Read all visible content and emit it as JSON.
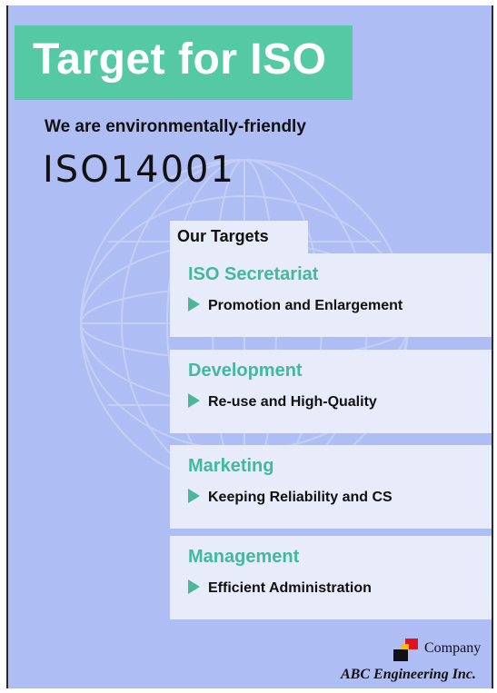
{
  "header": {
    "title": "Target for ISO"
  },
  "intro": {
    "tagline": "We are environmentally-friendly",
    "standard": "ISO14001"
  },
  "targets": {
    "heading": "Our Targets",
    "items": [
      {
        "title": "ISO Secretariat",
        "goal": "Promotion and Enlargement"
      },
      {
        "title": "Development",
        "goal": "Re-use and High-Quality"
      },
      {
        "title": "Marketing",
        "goal": "Keeping Reliability and CS"
      },
      {
        "title": "Management",
        "goal": "Efficient Administration"
      }
    ]
  },
  "footer": {
    "company_word": "Company",
    "company_name": "ABC Engineering Inc."
  },
  "colors": {
    "background": "#aebdf3",
    "banner": "#55c9a4",
    "accent": "#42b99c",
    "card": "#e7ebfa"
  },
  "icons": [
    "globe-graphic",
    "arrow-icon",
    "company-logo-icon"
  ]
}
